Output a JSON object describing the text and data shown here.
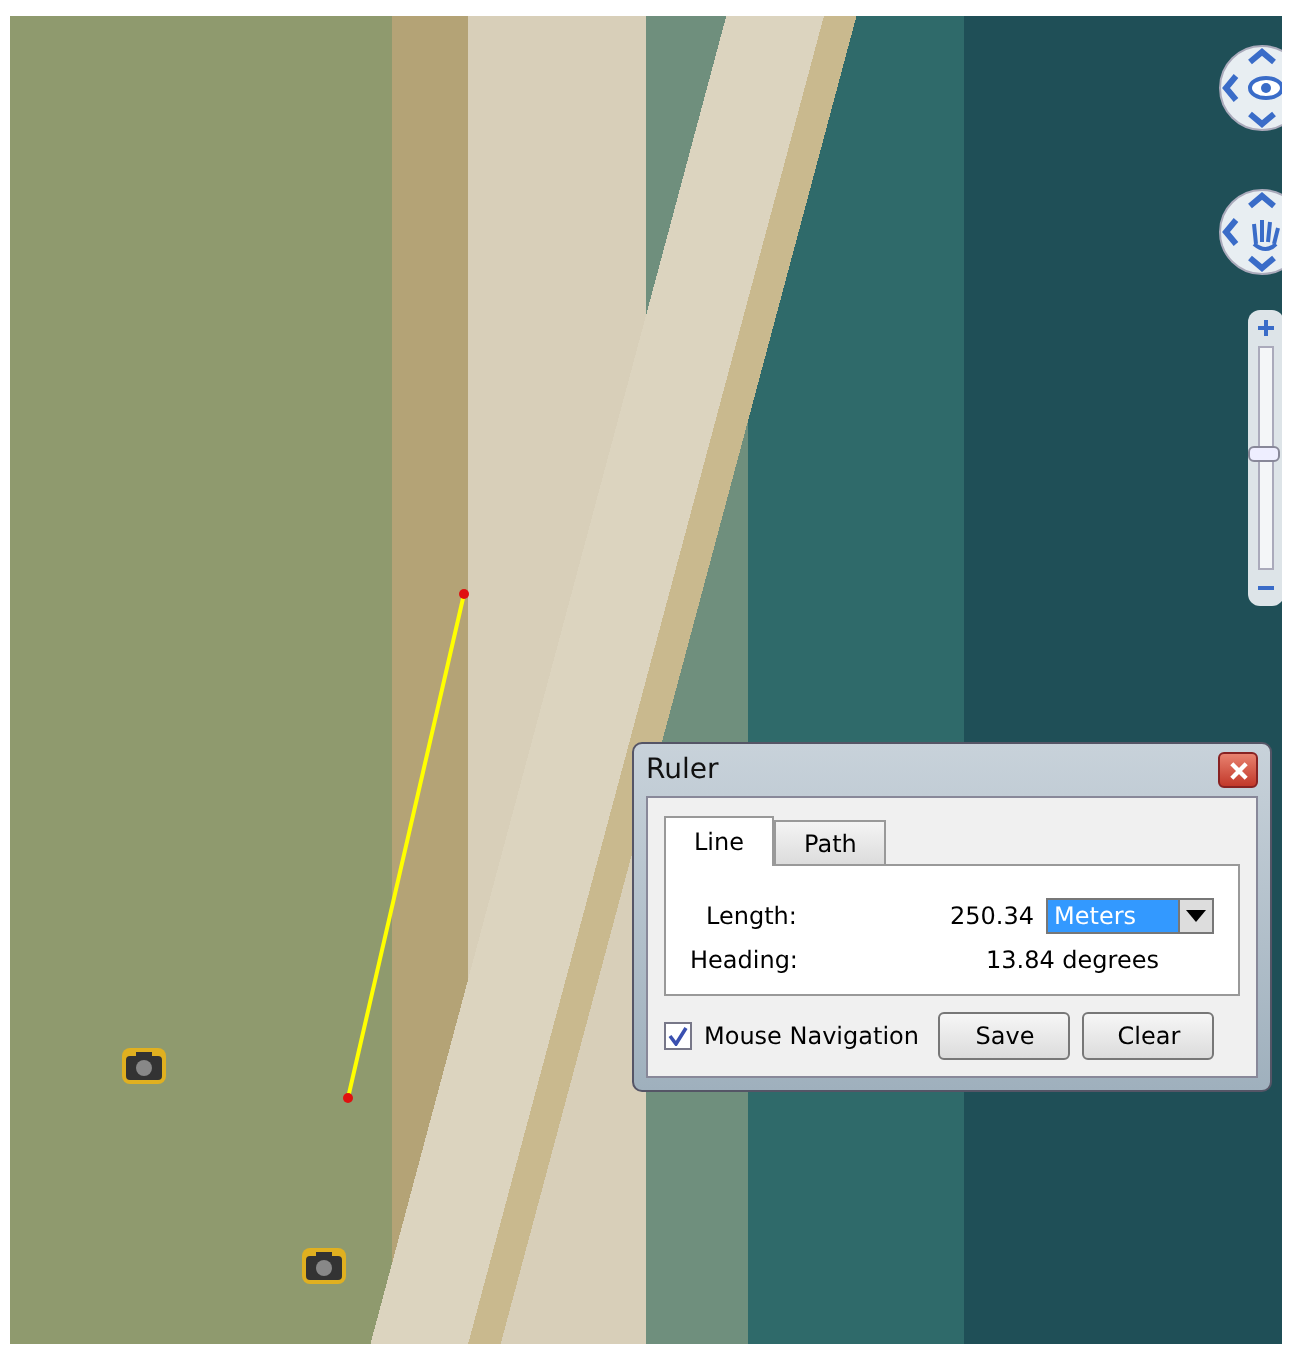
{
  "map": {
    "zoom_slider": {
      "level": 0.52
    }
  },
  "ruler_dialog": {
    "title": "Ruler",
    "tabs": [
      {
        "label": "Line",
        "selected": true
      },
      {
        "label": "Path",
        "selected": false
      }
    ],
    "length_label": "Length:",
    "length_value": "250.34",
    "unit": "Meters",
    "heading_label": "Heading:",
    "heading_value": "13.84 degrees",
    "mouse_navigation": {
      "label": "Mouse Navigation",
      "checked": true
    },
    "buttons": [
      "Save",
      "Clear"
    ]
  }
}
